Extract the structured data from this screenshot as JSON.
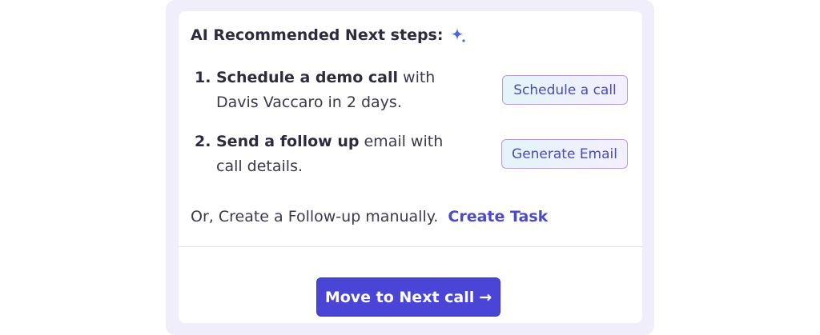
{
  "header": {
    "title": "AI Recommended Next steps:",
    "icon": "sparkle-icon",
    "icon_color": "#4a63e0"
  },
  "steps": [
    {
      "number": "1.",
      "bold": "Schedule a demo call",
      "rest_line1": " with",
      "rest_line2": "Davis Vaccaro in 2 days.",
      "button_label": "Schedule a call"
    },
    {
      "number": "2.",
      "bold": "Send a follow up",
      "rest_line1": " email with",
      "rest_line2": "call details.",
      "button_label": "Generate Email"
    }
  ],
  "manual": {
    "text": "Or, Create a Follow-up manually.",
    "link_label": "Create Task"
  },
  "footer": {
    "next_button_label": "Move to Next call",
    "next_button_arrow": "→"
  },
  "colors": {
    "accent": "#4a45d6",
    "link": "#4c4ac9",
    "frame": "#f1eefb"
  }
}
